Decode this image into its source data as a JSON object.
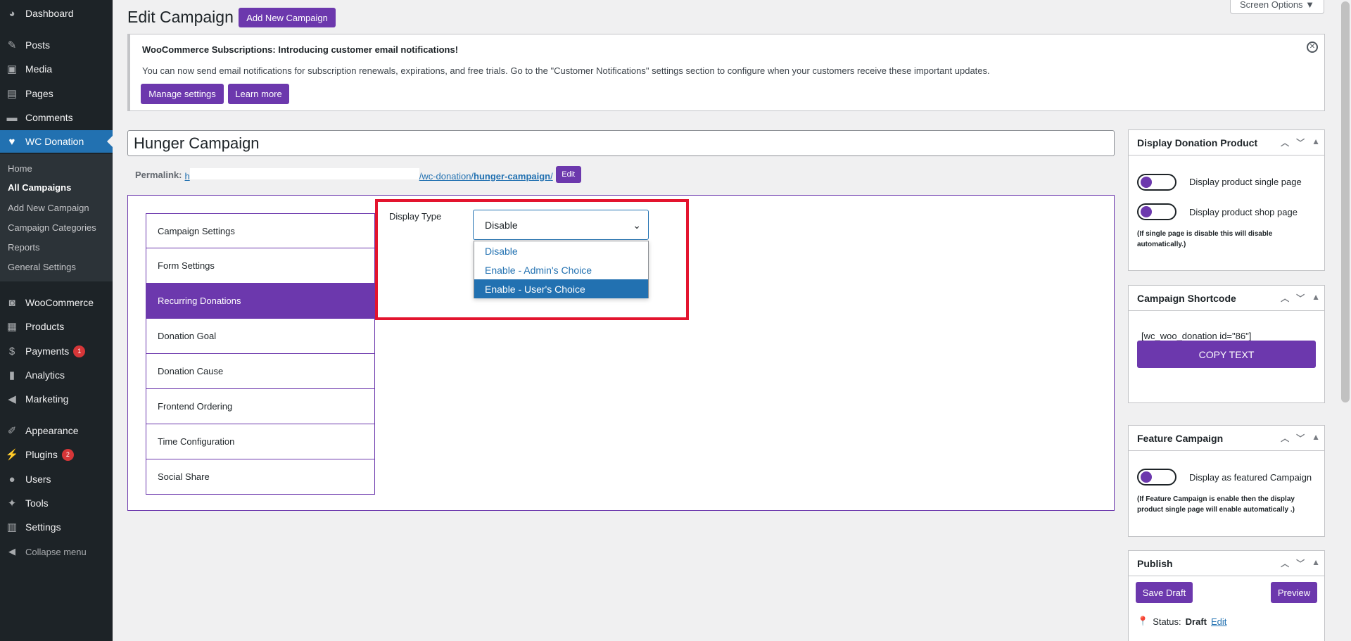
{
  "sidebar": {
    "menu": [
      {
        "label": "Dashboard",
        "icon": "dashboard-icon"
      },
      {
        "label": "Posts",
        "icon": "pin-icon"
      },
      {
        "label": "Media",
        "icon": "media-icon"
      },
      {
        "label": "Pages",
        "icon": "pages-icon"
      },
      {
        "label": "Comments",
        "icon": "comment-icon"
      },
      {
        "label": "WC Donation",
        "icon": "heart-icon"
      },
      {
        "label": "WooCommerce",
        "icon": "woo-icon"
      },
      {
        "label": "Products",
        "icon": "archive-icon"
      },
      {
        "label": "Payments",
        "icon": "dollar-icon",
        "badge": "1"
      },
      {
        "label": "Analytics",
        "icon": "chart-icon"
      },
      {
        "label": "Marketing",
        "icon": "megaphone-icon"
      },
      {
        "label": "Appearance",
        "icon": "brush-icon"
      },
      {
        "label": "Plugins",
        "icon": "plugin-icon",
        "badge": "2"
      },
      {
        "label": "Users",
        "icon": "user-icon"
      },
      {
        "label": "Tools",
        "icon": "wrench-icon"
      },
      {
        "label": "Settings",
        "icon": "settings-icon"
      }
    ],
    "submenu": [
      "Home",
      "All Campaigns",
      "Add New Campaign",
      "Campaign Categories",
      "Reports",
      "General Settings"
    ],
    "collapse": "Collapse menu"
  },
  "header": {
    "title": "Edit Campaign",
    "add_new": "Add New Campaign",
    "screen_options": "Screen Options ▼"
  },
  "notice": {
    "title": "WooCommerce Subscriptions: Introducing customer email notifications!",
    "text": "You can now send email notifications for subscription renewals, expirations, and free trials. Go to the \"Customer Notifications\" settings section to configure when your customers receive these important updates.",
    "btn_manage": "Manage settings",
    "btn_learn": "Learn more"
  },
  "post": {
    "title": "Hunger Campaign",
    "permalink_label": "Permalink:",
    "permalink_start": "h",
    "permalink_path": "/wc-donation/",
    "permalink_slug": "hunger-campaign",
    "permalink_end": "/",
    "edit": "Edit"
  },
  "tabs": [
    "Campaign Settings",
    "Form Settings",
    "Recurring Donations",
    "Donation Goal",
    "Donation Cause",
    "Frontend Ordering",
    "Time Configuration",
    "Social Share"
  ],
  "recurring": {
    "label": "Display Type",
    "selected": "Disable",
    "options": [
      "Disable",
      "Enable - Admin's Choice",
      "Enable - User's Choice"
    ]
  },
  "display_product": {
    "title": "Display Donation Product",
    "single": "Display product single page",
    "shop": "Display product shop page",
    "note": "(If single page is disable this will disable automatically.)"
  },
  "shortcode": {
    "title": "Campaign Shortcode",
    "code": "[wc_woo_donation id=\"86\"]",
    "copy": "COPY TEXT"
  },
  "feature": {
    "title": "Feature Campaign",
    "label": "Display as featured Campaign",
    "note": "(If Feature Campaign is enable then the display product single page will enable automatically .)"
  },
  "publish": {
    "title": "Publish",
    "save_draft": "Save Draft",
    "preview": "Preview",
    "status_label": "Status:",
    "status_value": "Draft",
    "status_edit": "Edit"
  },
  "colors": {
    "accent": "#6c38ad",
    "admin_blue": "#2271b1",
    "highlight": "#e3142e",
    "sidebar": "#1d2327"
  }
}
